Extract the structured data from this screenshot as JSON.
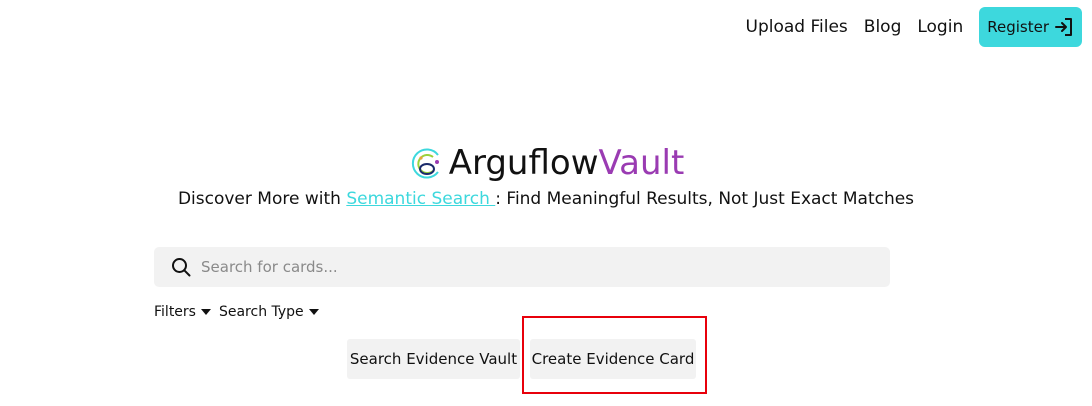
{
  "nav": {
    "upload_files": "Upload Files",
    "blog": "Blog",
    "login": "Login",
    "register": "Register",
    "register_icon": "login-arrow-icon"
  },
  "brand": {
    "name_part1": "Arguflow",
    "name_part2": "Vault",
    "logo_icon": "arguflow-logo",
    "accent_color": "#9a3bb2"
  },
  "tagline": {
    "prefix": "Discover More with ",
    "link": "Semantic Search ",
    "suffix": ": Find Meaningful Results, Not Just Exact Matches",
    "link_color": "#3dd8dd"
  },
  "search": {
    "placeholder": "Search for cards...",
    "value": "",
    "icon": "search-icon"
  },
  "filters": {
    "filters_label": "Filters",
    "search_type_label": "Search Type"
  },
  "actions": {
    "search_vault": "Search Evidence Vault",
    "create_card": "Create Evidence Card"
  },
  "colors": {
    "register_bg": "#3dd8dd",
    "highlight_border": "#e8000b"
  }
}
